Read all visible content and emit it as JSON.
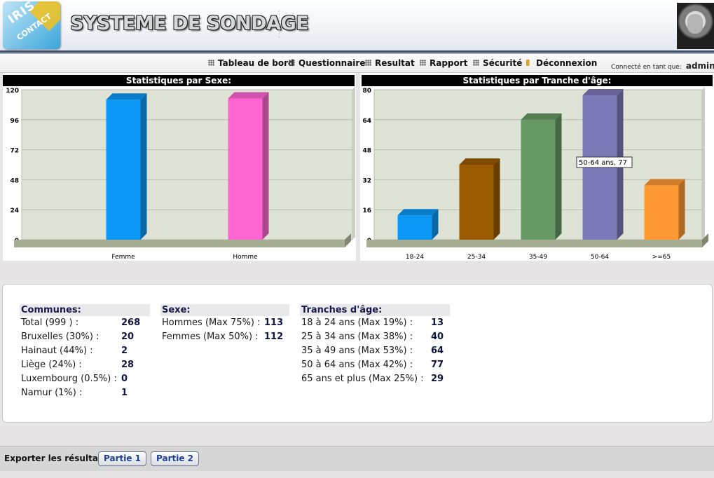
{
  "header": {
    "logo_text": "IRIS",
    "logo_subtext": "CONTACT",
    "app_title": "SYSTEME DE SONDAGE"
  },
  "nav": {
    "items": [
      "Tableau de bord",
      "Questionnaire",
      "Resultat",
      "Rapport",
      "Sécurité",
      "Déconnexion"
    ],
    "connected_label": "Connecté en tant que:",
    "user": "admin"
  },
  "chart_data": [
    {
      "type": "bar",
      "title": "Statistiques par Sexe:",
      "categories": [
        "Femme",
        "Homme"
      ],
      "values": [
        112,
        113
      ],
      "colors": [
        "#0a97f5",
        "#ff66d2"
      ],
      "ylim": [
        0,
        120
      ],
      "yticks": [
        0,
        24,
        48,
        72,
        96,
        120
      ],
      "grid": true
    },
    {
      "type": "bar",
      "title": "Statistiques par Tranche d'âge:",
      "categories": [
        "18-24",
        "25-34",
        "35-49",
        "50-64",
        ">=65"
      ],
      "values": [
        13,
        40,
        64,
        77,
        29
      ],
      "colors": [
        "#0a97f5",
        "#9a5a00",
        "#669966",
        "#7c79b8",
        "#ff9933"
      ],
      "ylim": [
        0,
        80
      ],
      "yticks": [
        0,
        16,
        32,
        48,
        64,
        80
      ],
      "grid": true,
      "tooltip": "50-64 ans, 77"
    }
  ],
  "stats": {
    "communes": {
      "heading": "Communes:",
      "rows": [
        {
          "label": "Total (999 ) :",
          "value": "268"
        },
        {
          "label": "Bruxelles (30%) :",
          "value": "20"
        },
        {
          "label": "Hainaut (44%) :",
          "value": "2"
        },
        {
          "label": "Liège (24%) :",
          "value": "28"
        },
        {
          "label": "Luxembourg (0.5%) :",
          "value": "0"
        },
        {
          "label": "Namur (1%) :",
          "value": "1"
        }
      ]
    },
    "sexe": {
      "heading": "Sexe:",
      "rows": [
        {
          "label": "Hommes (Max 75%) :",
          "value": "113"
        },
        {
          "label": "Femmes (Max 50%) :",
          "value": "112"
        }
      ]
    },
    "ages": {
      "heading": "Tranches d'âge:",
      "rows": [
        {
          "label": "18 à 24 ans (Max 19%) :",
          "value": "13"
        },
        {
          "label": "25 à 34 ans (Max 38%) :",
          "value": "40"
        },
        {
          "label": "35 à 49 ans (Max 53%) :",
          "value": "64"
        },
        {
          "label": "50 à 64 ans (Max 42%) :",
          "value": "77"
        },
        {
          "label": "65 ans et plus (Max 25%) :",
          "value": "29"
        }
      ]
    }
  },
  "footer": {
    "export_label": "Exporter les résultats:",
    "buttons": [
      "Partie 1",
      "Partie 2"
    ]
  }
}
